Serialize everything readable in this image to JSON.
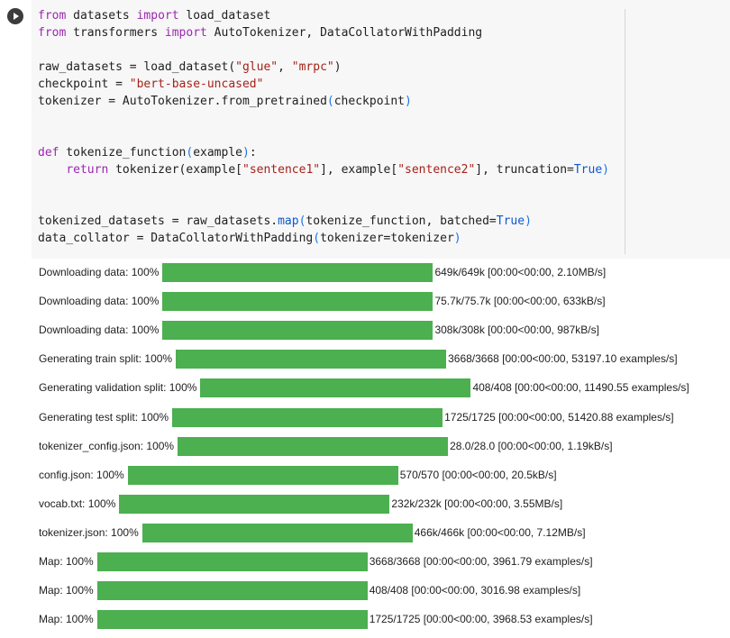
{
  "code_lines": [
    [
      [
        "kw",
        "from"
      ],
      [
        "t",
        " datasets "
      ],
      [
        "kw",
        "import"
      ],
      [
        "t",
        " load_dataset"
      ]
    ],
    [
      [
        "kw",
        "from"
      ],
      [
        "t",
        " transformers "
      ],
      [
        "kw",
        "import"
      ],
      [
        "t",
        " AutoTokenizer, DataCollatorWithPadding"
      ]
    ],
    [],
    [
      [
        "t",
        "raw_datasets = load_dataset("
      ],
      [
        "st",
        "\"glue\""
      ],
      [
        "t",
        ", "
      ],
      [
        "st",
        "\"mrpc\""
      ],
      [
        "t",
        ")"
      ]
    ],
    [
      [
        "t",
        "checkpoint = "
      ],
      [
        "st",
        "\"bert-base-uncased\""
      ]
    ],
    [
      [
        "t",
        "tokenizer = AutoTokenizer.from_pretrained"
      ],
      [
        "br",
        "("
      ],
      [
        "t",
        "checkpoint"
      ],
      [
        "br",
        ")"
      ]
    ],
    [],
    [],
    [
      [
        "kw",
        "def"
      ],
      [
        "t",
        " tokenize_function"
      ],
      [
        "br",
        "("
      ],
      [
        "t",
        "example"
      ],
      [
        "br",
        ")"
      ],
      [
        "t",
        ":"
      ]
    ],
    [
      [
        "t",
        "    "
      ],
      [
        "kw",
        "return"
      ],
      [
        "t",
        " tokenizer(example["
      ],
      [
        "st",
        "\"sentence1\""
      ],
      [
        "t",
        "], example["
      ],
      [
        "st",
        "\"sentence2\""
      ],
      [
        "t",
        "], truncation="
      ],
      [
        "fn",
        "True"
      ],
      [
        "br",
        ")"
      ]
    ],
    [],
    [],
    [
      [
        "t",
        "tokenized_datasets = raw_datasets."
      ],
      [
        "fn",
        "map"
      ],
      [
        "br",
        "("
      ],
      [
        "t",
        "tokenize_function, batched="
      ],
      [
        "fn",
        "True"
      ],
      [
        "br",
        ")"
      ]
    ],
    [
      [
        "t",
        "data_collator = DataCollatorWithPadding"
      ],
      [
        "br",
        "("
      ],
      [
        "t",
        "tokenizer=tokenizer"
      ],
      [
        "br",
        ")"
      ]
    ]
  ],
  "progress": [
    {
      "label": "Downloading data: 100%",
      "status": "649k/649k [00:00<00:00, 2.10MB/s]",
      "fraction": 1.0
    },
    {
      "label": "Downloading data: 100%",
      "status": "75.7k/75.7k [00:00<00:00, 633kB/s]",
      "fraction": 1.0
    },
    {
      "label": "Downloading data: 100%",
      "status": "308k/308k [00:00<00:00, 987kB/s]",
      "fraction": 1.0
    },
    {
      "label": "Generating train split: 100%",
      "status": "3668/3668 [00:00<00:00, 53197.10 examples/s]",
      "fraction": 1.0
    },
    {
      "label": "Generating validation split: 100%",
      "status": "408/408 [00:00<00:00, 11490.55 examples/s]",
      "fraction": 1.0
    },
    {
      "label": "Generating test split: 100%",
      "status": "1725/1725 [00:00<00:00, 51420.88 examples/s]",
      "fraction": 1.0
    },
    {
      "label": "tokenizer_config.json: 100%",
      "status": "28.0/28.0 [00:00<00:00, 1.19kB/s]",
      "fraction": 1.0
    },
    {
      "label": "config.json: 100%",
      "status": "570/570 [00:00<00:00, 20.5kB/s]",
      "fraction": 1.0
    },
    {
      "label": "vocab.txt: 100%",
      "status": "232k/232k [00:00<00:00, 3.55MB/s]",
      "fraction": 1.0
    },
    {
      "label": "tokenizer.json: 100%",
      "status": "466k/466k [00:00<00:00, 7.12MB/s]",
      "fraction": 1.0
    },
    {
      "label": "Map: 100%",
      "status": "3668/3668 [00:00<00:00, 3961.79 examples/s]",
      "fraction": 1.0
    },
    {
      "label": "Map: 100%",
      "status": "408/408 [00:00<00:00, 3016.98 examples/s]",
      "fraction": 1.0
    },
    {
      "label": "Map: 100%",
      "status": "1725/1725 [00:00<00:00, 3968.53 examples/s]",
      "fraction": 1.0
    }
  ],
  "colors": {
    "progress_bar": "#4caf50",
    "keyword": "#9c27b0",
    "string": "#a5221a",
    "builtin": "#0b57d0"
  },
  "icons": {
    "run": "play-circle-icon"
  }
}
